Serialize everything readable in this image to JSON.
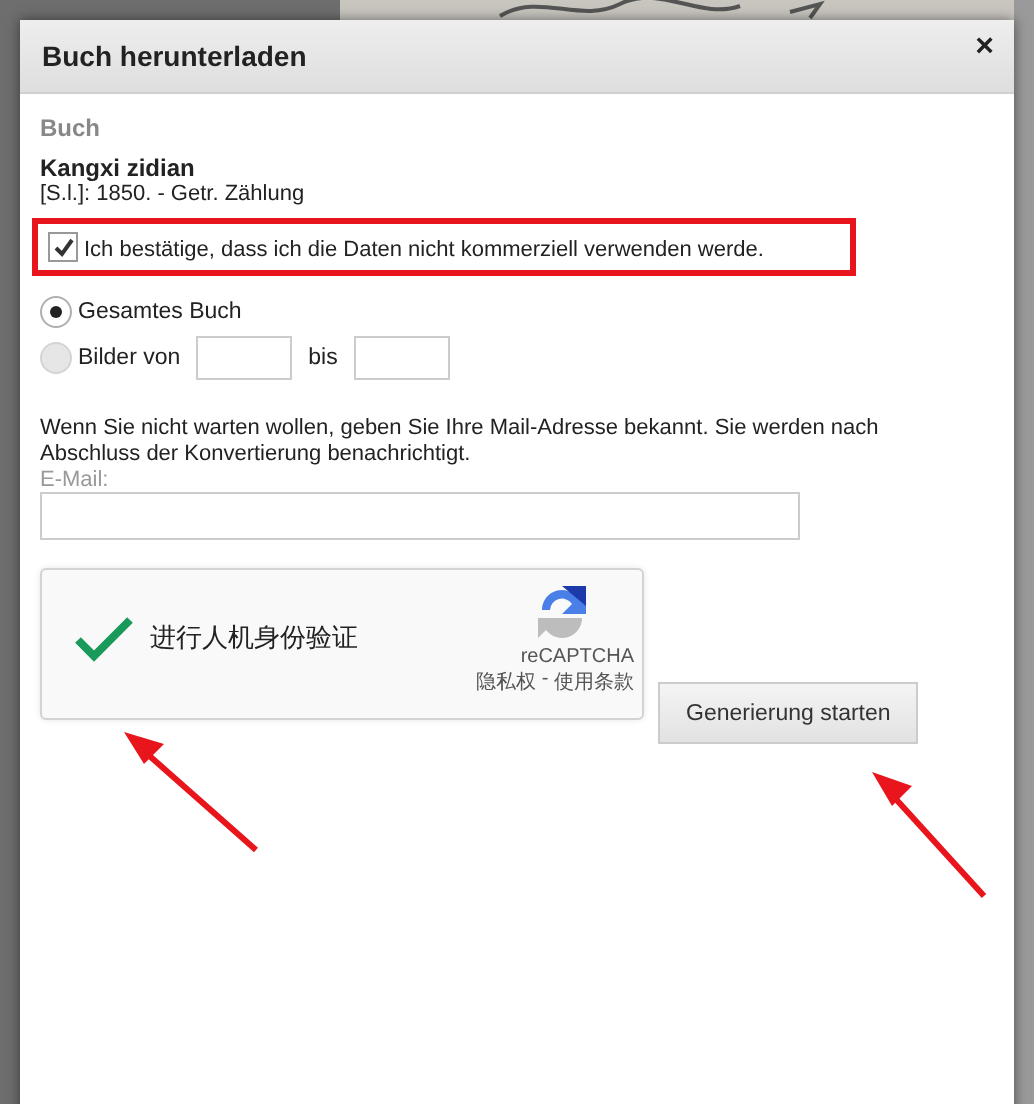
{
  "dialog": {
    "title": "Buch herunterladen",
    "close": "×"
  },
  "book": {
    "heading": "Buch",
    "title": "Kangxi zidian",
    "meta": "[S.l.]: 1850. - Getr. Zählung"
  },
  "consent": {
    "label": "Ich bestätige, dass ich die Daten nicht kommerziell verwenden werde.",
    "checked": true
  },
  "range_options": [
    {
      "kind": "all",
      "label": "Gesamtes Buch",
      "selected": true
    },
    {
      "kind": "range",
      "label": "Bilder von",
      "to_label": "bis",
      "selected": false
    }
  ],
  "notice": "Wenn Sie nicht warten wollen, geben Sie Ihre Mail-Adresse bekannt. Sie werden nach Abschluss der Konvertierung benachrichtigt.",
  "email": {
    "label": "E-Mail:"
  },
  "captcha": {
    "label": "进行人机身份验证",
    "checked": true,
    "brand": "reCAPTCHA",
    "privacy": "隐私权",
    "separator": " - ",
    "terms": "使用条款"
  },
  "button": "Generierung starten"
}
